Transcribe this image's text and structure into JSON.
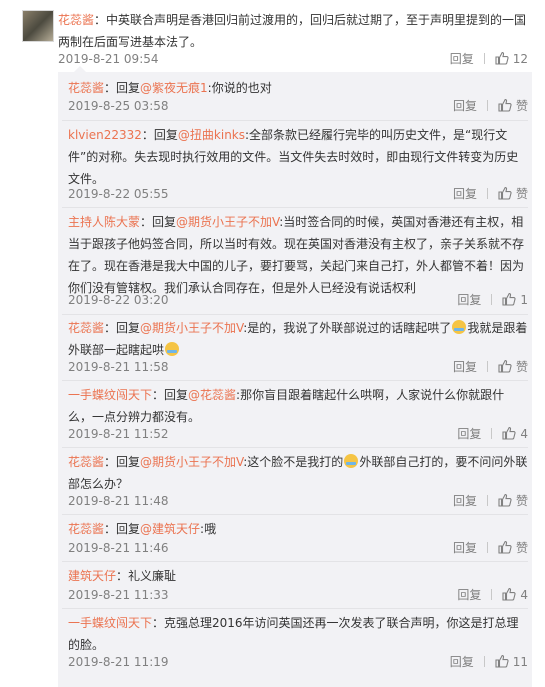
{
  "main": {
    "user": "花蕊酱",
    "text": "：中英联合声明是香港回归前过渡用的，回归后就过期了，至于声明里提到的一国两制在后面写进基本法了。",
    "date": "2019-8-21 09:54",
    "reply_label": "回复",
    "likes": "12"
  },
  "replies": [
    {
      "user": "花蕊酱",
      "pre": "：回复",
      "at": "@紫夜无痕1",
      "text": ":你说的也对",
      "date": "2019-8-25 03:58",
      "reply_label": "回复",
      "likes": "赞"
    },
    {
      "user": "klvien22332",
      "pre": "：回复",
      "at": "@扭曲kinks",
      "text": ":全部条款已经履行完毕的叫历史文件，是“现行文件”的对称。失去现时执行效用的文件。当文件失去时效时，即由现行文件转变为历史文件。",
      "date": "2019-8-22 05:55",
      "reply_label": "回复",
      "likes": "赞"
    },
    {
      "user": "主持人陈大蒙",
      "pre": "：回复",
      "at": "@期货小王子不加V",
      "text": ":当时签合同的时候，英国对香港还有主权，相当于跟孩子他妈签合同，所以当时有效。现在英国对香港没有主权了，亲子关系就不存在了。现在香港是我大中国的儿子，要打要骂，关起门来自己打，外人都管不着！因为你们没有管辖权。我们承认合同存在，但是外人已经没有说话权利",
      "date": "2019-8-22 03:20",
      "reply_label": "回复",
      "likes": "1"
    },
    {
      "user": "花蕊酱",
      "pre": "：回复",
      "at": "@期货小王子不加V",
      "text1": ":是的，我说了外联部说过的话瞎起哄了",
      "text2": "我就是跟着外联部一起瞎起哄",
      "date": "2019-8-21 11:58",
      "reply_label": "回复",
      "likes": "赞"
    },
    {
      "user": "一手蝶纹闯天下",
      "pre": "：回复",
      "at": "@花蕊酱",
      "text": ":那你盲目跟着瞎起什么哄啊，人家说什么你就跟什么，一点分辨力都没有。",
      "date": "2019-8-21 11:52",
      "reply_label": "回复",
      "likes": "4"
    },
    {
      "user": "花蕊酱",
      "pre": "：回复",
      "at": "@期货小王子不加V",
      "text1": ":这个脸不是我打的",
      "text2": "外联部自己打的，要不问问外联部怎么办？",
      "date": "2019-8-21 11:48",
      "reply_label": "回复",
      "likes": "赞"
    },
    {
      "user": "花蕊酱",
      "pre": "：回复",
      "at": "@建筑天仔",
      "text": ":哦",
      "date": "2019-8-21 11:46",
      "reply_label": "回复",
      "likes": "赞"
    },
    {
      "user": "建筑天仔",
      "pre": "：礼义廉耻",
      "date": "2019-8-21 11:33",
      "reply_label": "回复",
      "likes": "4"
    },
    {
      "user": "一手蝶纹闯天下",
      "pre": "：克强总理2016年访问英国还再一次发表了联合声明，你这是打总理的脸。",
      "date": "2019-8-21 11:19",
      "reply_label": "回复",
      "likes": "11"
    }
  ]
}
